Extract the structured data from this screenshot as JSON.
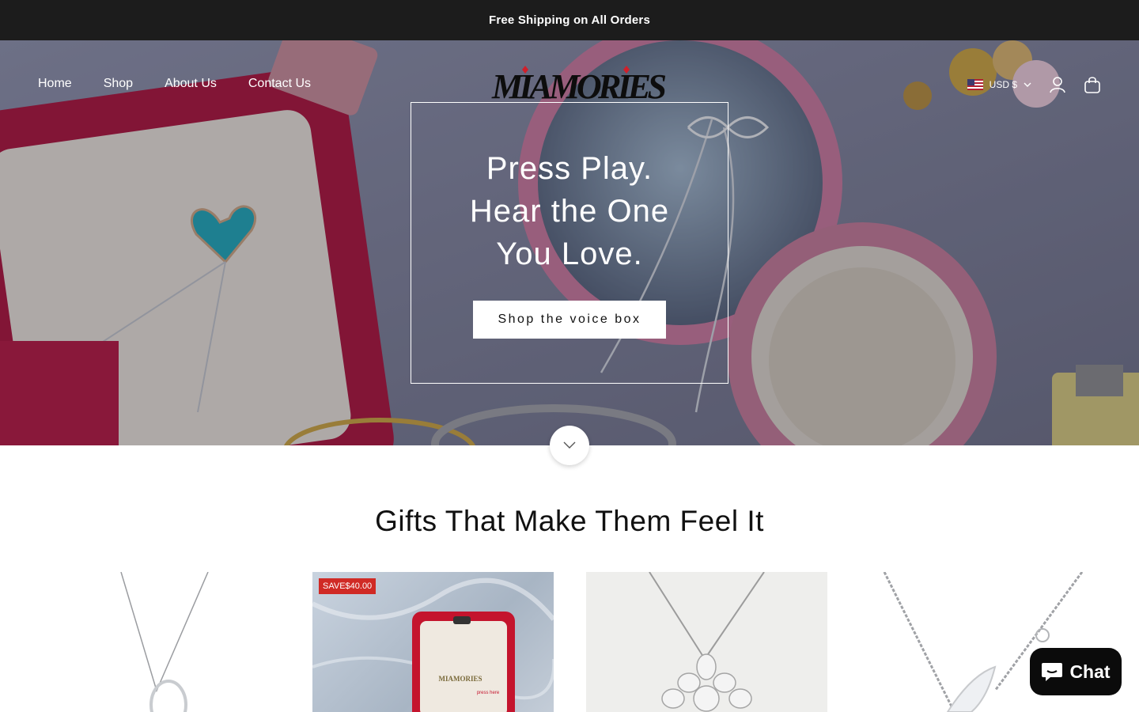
{
  "announcement": {
    "text": "Free Shipping on All Orders"
  },
  "header": {
    "nav": [
      "Home",
      "Shop",
      "About Us",
      "Contact Us"
    ],
    "logo_text": "MIAMORIES",
    "currency": "USD $"
  },
  "hero": {
    "title_lines": [
      "Press Play.",
      "Hear the One",
      "You Love."
    ],
    "cta": "Shop the voice box"
  },
  "section": {
    "title": "Gifts That Make Them Feel It"
  },
  "products": [
    {
      "badge": ""
    },
    {
      "badge": "SAVE$40.00",
      "box_text": "MIAMORIES",
      "press_text": "press here"
    },
    {
      "badge": ""
    },
    {
      "badge": ""
    }
  ],
  "chat": {
    "label": "Chat"
  },
  "colors": {
    "announcement_bg": "#1c1c1c",
    "badge_red": "#d02a25",
    "chat_bg": "#0b0b0b"
  }
}
